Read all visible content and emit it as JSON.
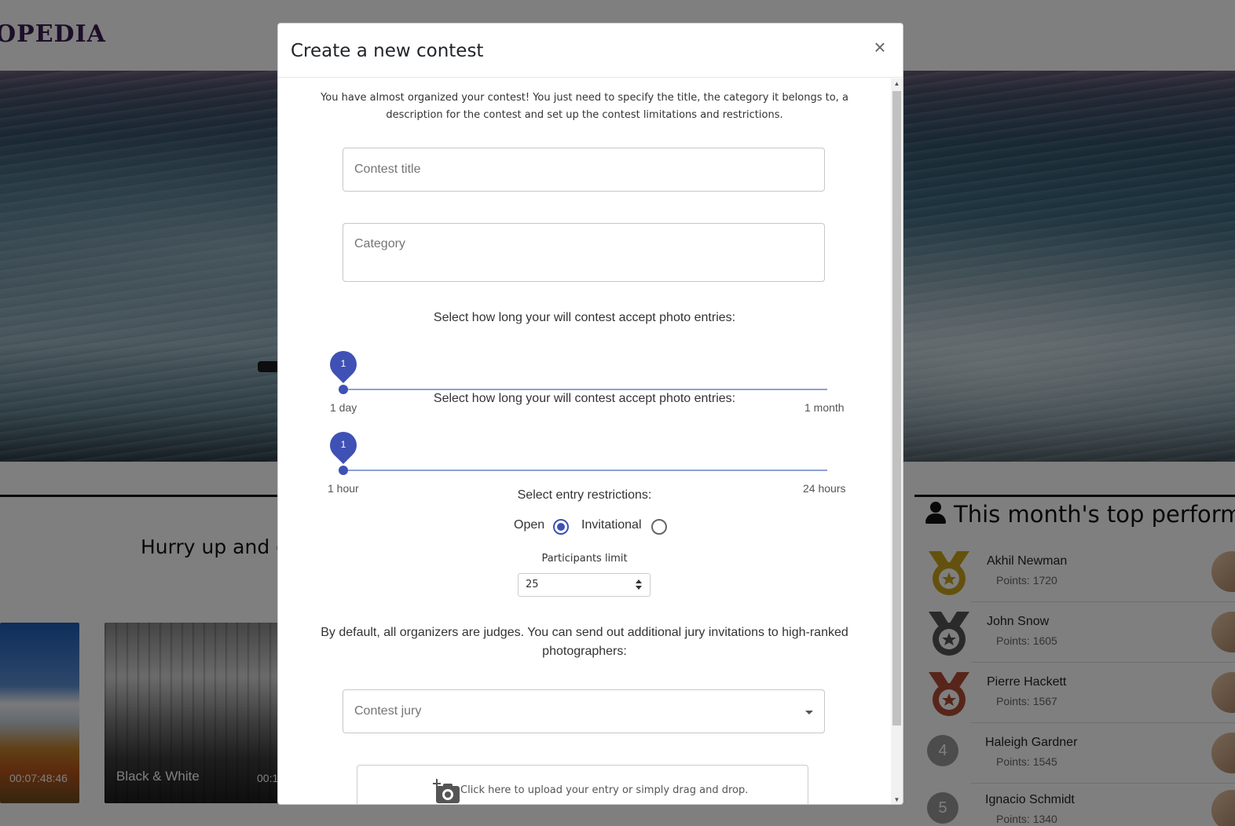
{
  "background": {
    "logo": "OPEDIA",
    "hurry_text": "Hurry up and g",
    "cards": [
      {
        "time": "00:07:48:46",
        "label": ""
      },
      {
        "time": "00:1",
        "label": "Black & White"
      }
    ],
    "performers": {
      "title": "This month's top perform",
      "items": [
        {
          "rank": "1",
          "name": "Akhil Newman",
          "points": "Points: 1720",
          "medal": "gold"
        },
        {
          "rank": "2",
          "name": "John Snow",
          "points": "Points: 1605",
          "medal": "silver"
        },
        {
          "rank": "3",
          "name": "Pierre Hackett",
          "points": "Points: 1567",
          "medal": "bronze"
        },
        {
          "rank": "4",
          "name": "Haleigh Gardner",
          "points": "Points: 1545",
          "medal": ""
        },
        {
          "rank": "5",
          "name": "Ignacio Schmidt",
          "points": "Points: 1340",
          "medal": ""
        }
      ]
    }
  },
  "modal": {
    "title": "Create a new contest",
    "close_label": "×",
    "intro": "You have almost organized your contest! You just need to specify the title, the category it belongs to, a description for the contest and set up the contest limitations and restrictions.",
    "contest_title_placeholder": "Contest title",
    "category_placeholder": "Category",
    "slider1": {
      "label": "Select how long your will contest accept photo entries:",
      "value": "1",
      "min_label": "1 day",
      "max_label": "1 month"
    },
    "slider2": {
      "label": "Select how long your will contest accept photo entries:",
      "value": "1",
      "min_label": "1 hour",
      "max_label": "24 hours"
    },
    "restrictions": {
      "label": "Select entry restrictions:",
      "options": [
        "Open",
        "Invitational"
      ],
      "selected": "Open"
    },
    "participants": {
      "label": "Participants limit",
      "value": "25"
    },
    "jury_info": "By default, all organizers are judges. You can send out additional jury invitations to high-ranked photographers:",
    "jury_placeholder": "Contest jury",
    "upload_text": "Click here to upload your entry or simply drag and drop."
  },
  "colors": {
    "accent": "#3f51b5",
    "overlay": "rgba(0,0,0,0.5)"
  },
  "icons": [
    "close-icon",
    "user-icon",
    "medal-icon",
    "camera-plus-icon",
    "caret-down-icon",
    "select-arrows-icon"
  ]
}
